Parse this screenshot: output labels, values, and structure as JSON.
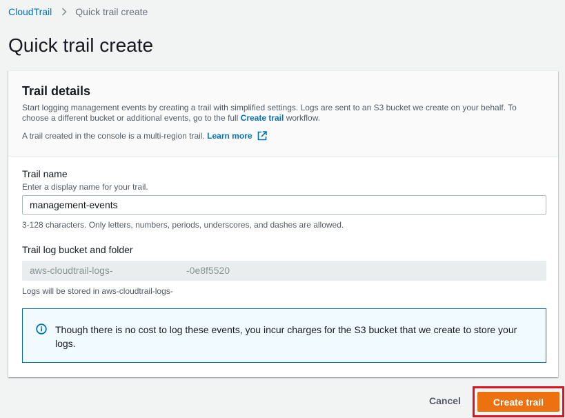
{
  "breadcrumb": {
    "root": "CloudTrail",
    "current": "Quick trail create"
  },
  "page": {
    "title": "Quick trail create"
  },
  "panel": {
    "title": "Trail details",
    "description_part1": "Start logging management events by creating a trail with simplified settings. Logs are sent to an S3 bucket we create on your behalf. To choose a different bucket or additional events, go to the full ",
    "description_link": "Create trail",
    "description_part2": " workflow.",
    "multi_region_text": "A trail created in the console is a multi-region trail. ",
    "learn_more": "Learn more"
  },
  "trail_name": {
    "label": "Trail name",
    "description": "Enter a display name for your trail.",
    "value": "management-events",
    "constraint": "3-128 characters. Only letters, numbers, periods, underscores, and dashes are allowed."
  },
  "bucket": {
    "label": "Trail log bucket and folder",
    "value_prefix": "aws-cloudtrail-logs-",
    "value_suffix": "-0e8f5520",
    "note": "Logs will be stored in aws-cloudtrail-logs-"
  },
  "info": {
    "text": "Though there is no cost to log these events, you incur charges for the S3 bucket that we create to store your logs."
  },
  "actions": {
    "cancel": "Cancel",
    "create": "Create trail"
  },
  "colors": {
    "link": "#0073bb",
    "primary_button": "#ec7211",
    "highlight_border": "#e0101d",
    "info_border": "#0073bb",
    "info_background": "#f1faff"
  },
  "icons": {
    "breadcrumb_separator": "chevron-right-icon",
    "external_link": "external-link-icon",
    "info": "info-icon"
  }
}
